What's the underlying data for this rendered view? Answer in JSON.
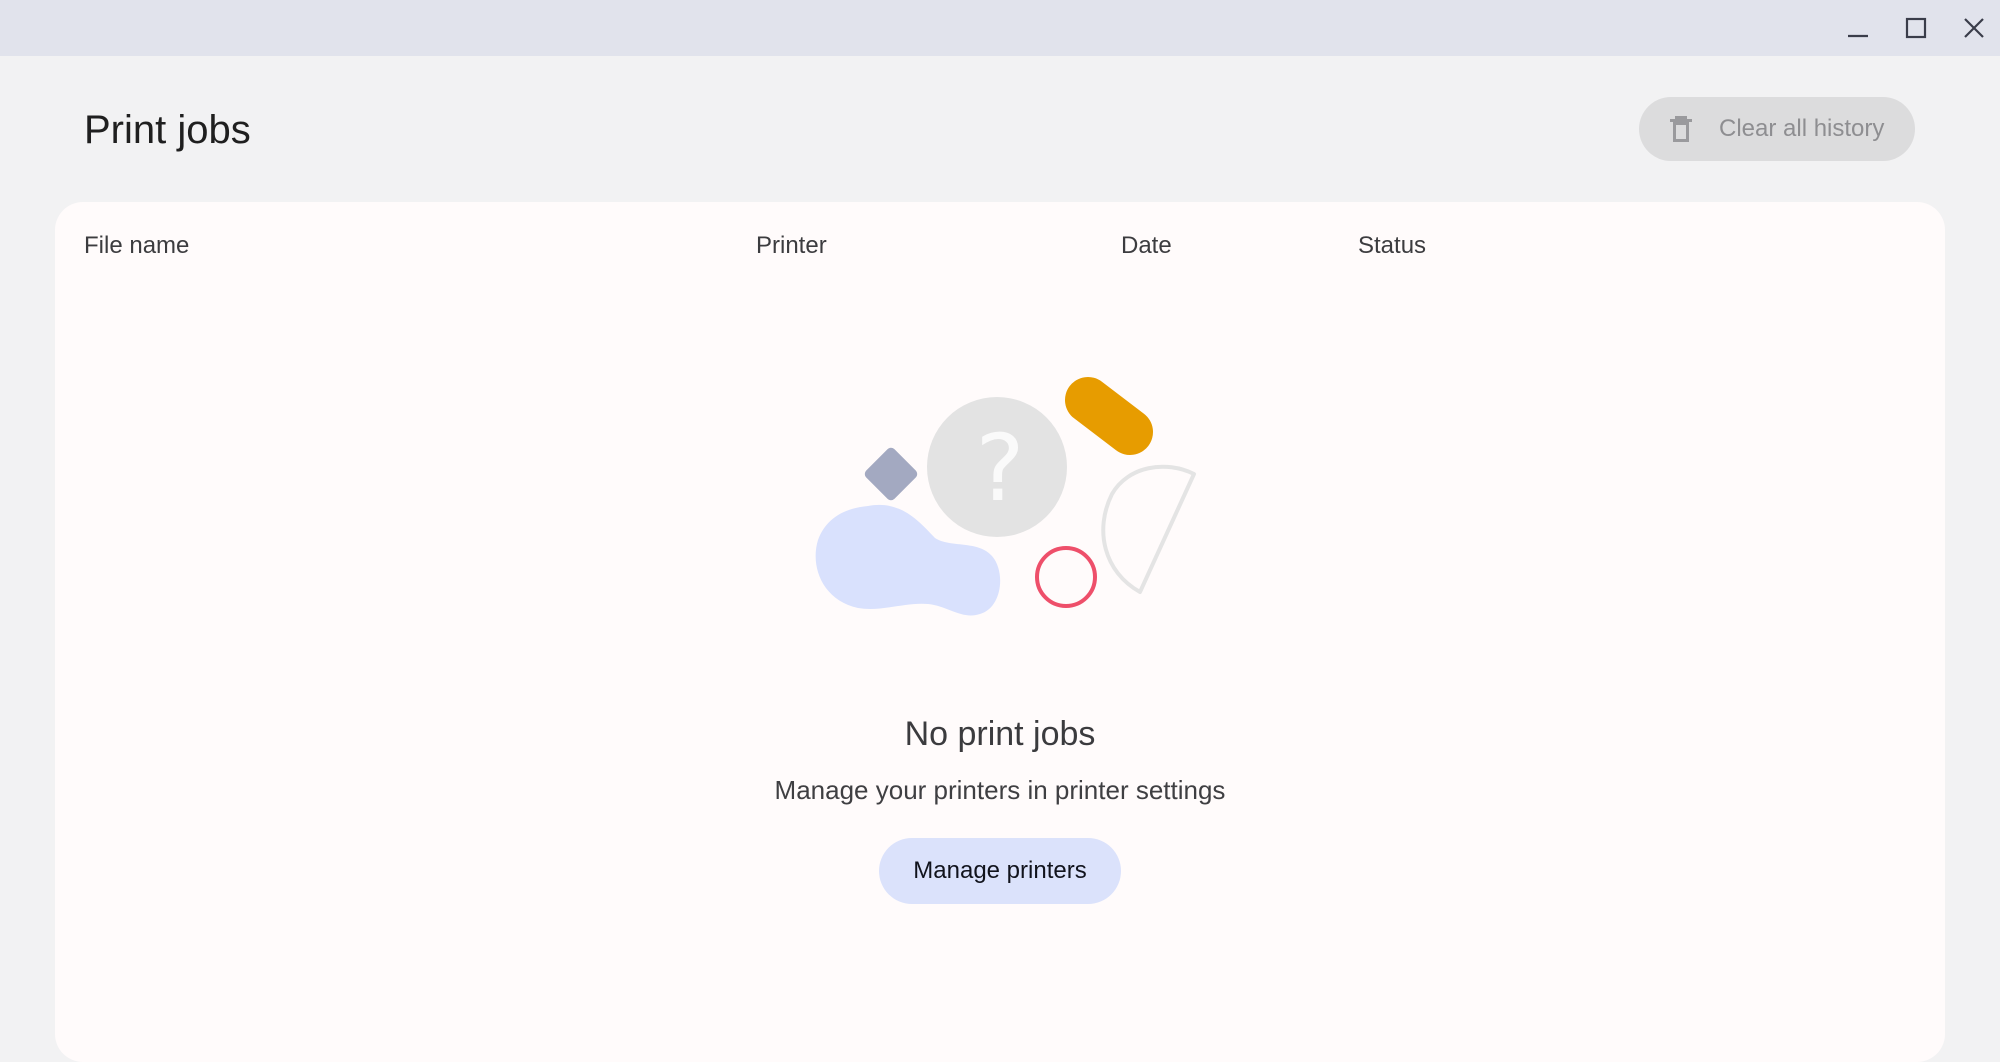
{
  "window": {
    "minimize_icon": "minimize-icon",
    "maximize_icon": "maximize-icon",
    "close_icon": "close-icon"
  },
  "header": {
    "title": "Print jobs",
    "clear_button_label": "Clear all history",
    "clear_button_icon": "trash-icon",
    "clear_button_enabled": false
  },
  "table": {
    "columns": [
      "File name",
      "Printer",
      "Date",
      "Status"
    ]
  },
  "empty_state": {
    "title": "No print jobs",
    "subtitle": "Manage your printers in printer settings",
    "button_label": "Manage printers"
  },
  "colors": {
    "titlebar": "#e1e3ec",
    "background": "#f2f2f3",
    "card": "#fffbfb",
    "accent_button": "#dbe2fb",
    "illustration_orange": "#e79c00",
    "illustration_red": "#ee4f6a",
    "illustration_blue": "#d9e1fd",
    "illustration_slate": "#a3a9c1"
  }
}
